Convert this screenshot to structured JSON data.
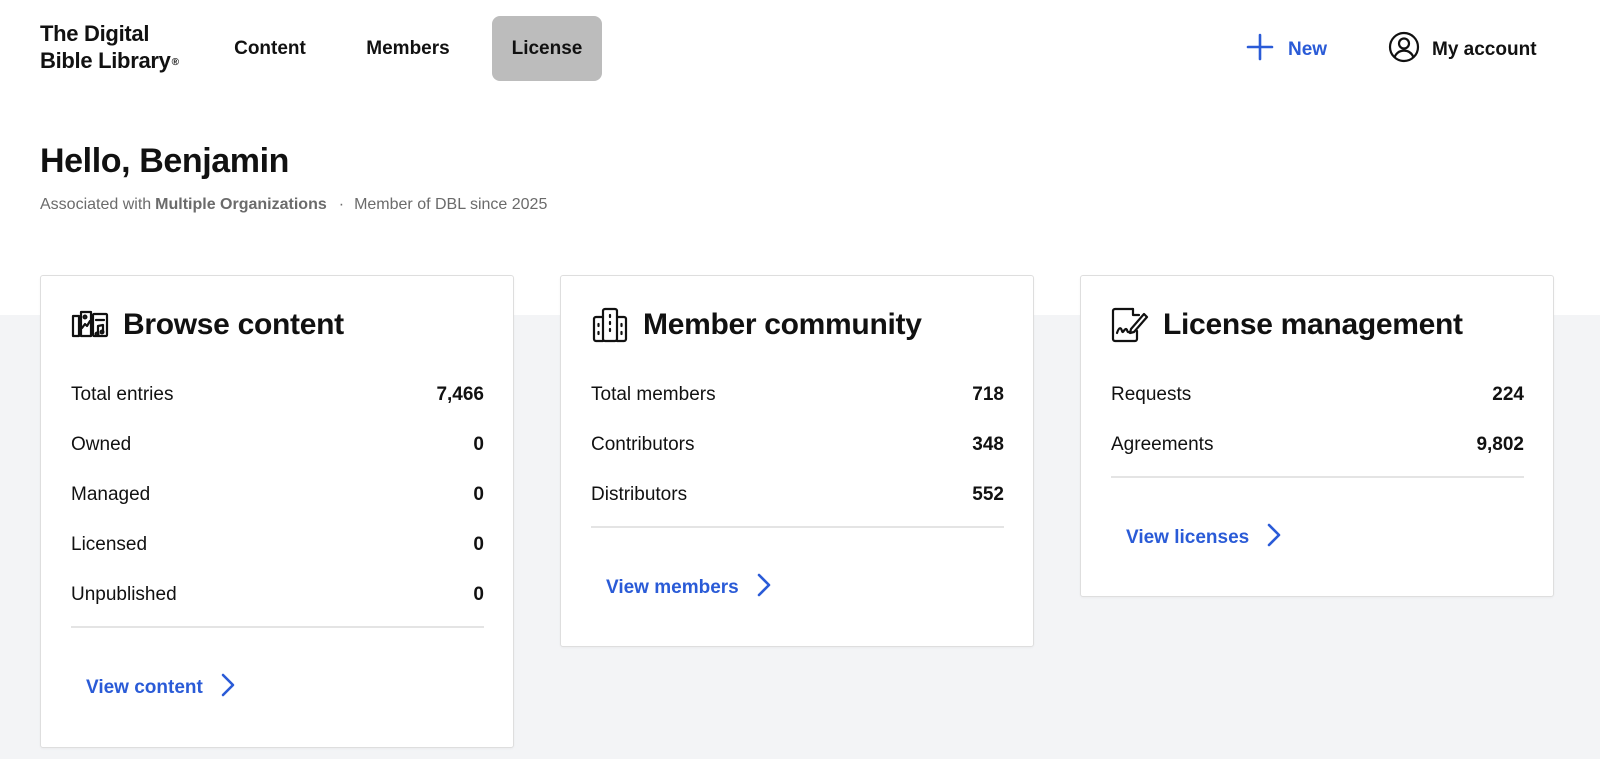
{
  "header": {
    "logo_line1": "The Digital",
    "logo_line2": "Bible Library",
    "logo_mark": "®",
    "tabs": [
      {
        "label": "Content"
      },
      {
        "label": "Members"
      },
      {
        "label": "License",
        "active": true
      }
    ],
    "new_label": "New",
    "account_label": "My account"
  },
  "greeting": {
    "title": "Hello, Benjamin",
    "associated_prefix": "Associated with",
    "associated_org": "Multiple Organizations",
    "separator": "·",
    "member_since": "Member of DBL since 2025"
  },
  "cards": {
    "browse": {
      "title": "Browse content",
      "icon": "content-library-icon",
      "rows": [
        {
          "label": "Total entries",
          "value": "7,466"
        },
        {
          "label": "Owned",
          "value": "0"
        },
        {
          "label": "Managed",
          "value": "0"
        },
        {
          "label": "Licensed",
          "value": "0"
        },
        {
          "label": "Unpublished",
          "value": "0"
        }
      ],
      "link": "View content"
    },
    "members": {
      "title": "Member community",
      "icon": "building-icon",
      "rows": [
        {
          "label": "Total members",
          "value": "718"
        },
        {
          "label": "Contributors",
          "value": "348"
        },
        {
          "label": "Distributors",
          "value": "552"
        }
      ],
      "link": "View members"
    },
    "license": {
      "title": "License management",
      "icon": "signed-document-icon",
      "rows": [
        {
          "label": "Requests",
          "value": "224"
        },
        {
          "label": "Agreements",
          "value": "9,802"
        }
      ],
      "link": "View licenses"
    }
  },
  "colors": {
    "accent": "#2a5bd7",
    "active_tab": "#bcbcbc",
    "band": "#f3f4f6"
  }
}
